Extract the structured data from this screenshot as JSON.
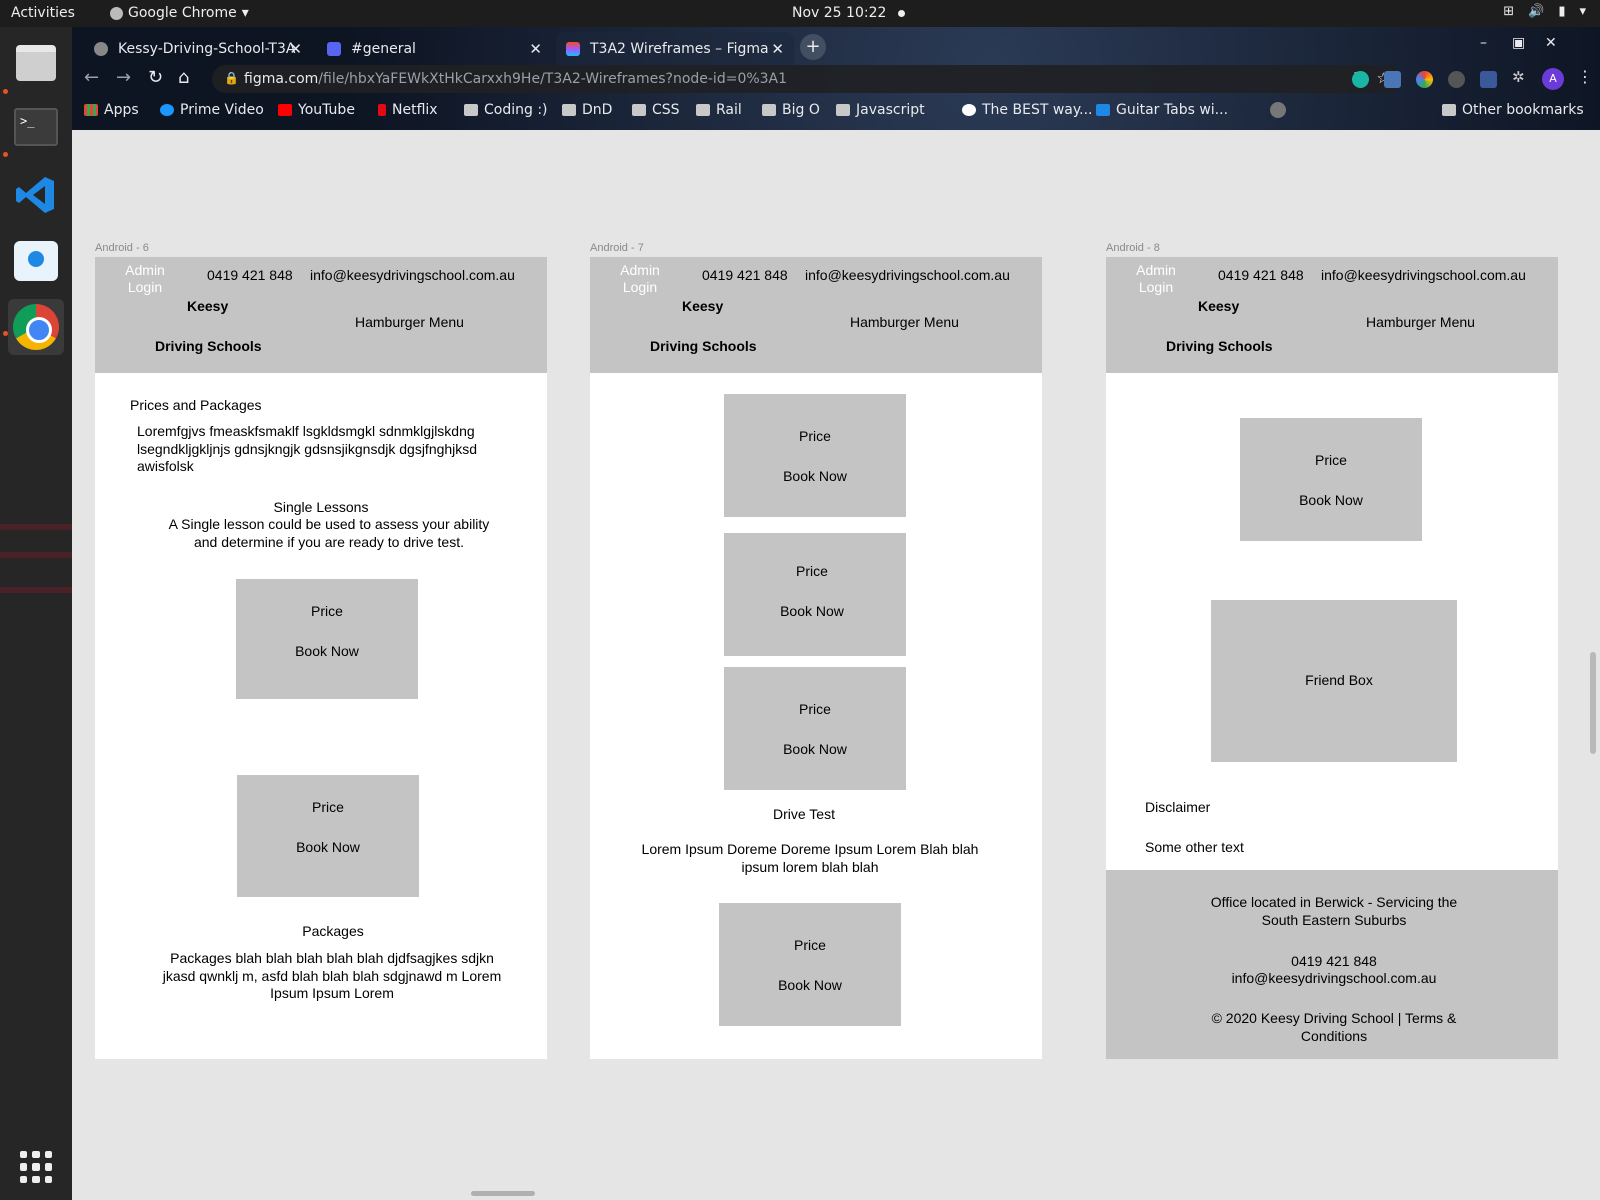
{
  "topbar": {
    "activities": "Activities",
    "app": "Google Chrome",
    "clock": "Nov 25  10:22"
  },
  "browser": {
    "tabs": [
      {
        "title": "Kessy-Driving-School-T3A",
        "icon": "github-icon"
      },
      {
        "title": "#general",
        "icon": "discord-icon"
      },
      {
        "title": "T3A2 Wireframes – Figma",
        "icon": "figma-icon"
      }
    ],
    "url_host": "figma.com",
    "url_path": "/file/hbxYaFEWkXtHkCarxxh9He/T3A2-Wireframes?node-id=0%3A1",
    "avatar_initial": "A",
    "bookmarks": [
      "Apps",
      "Prime Video",
      "YouTube",
      "Netflix",
      "Coding :)",
      "DnD",
      "CSS",
      "Rail",
      "Big O",
      "Javascript",
      "The BEST way...",
      "Guitar Tabs wi...",
      "Other bookmarks"
    ]
  },
  "header": {
    "admin_login": "Admin Login",
    "phone": "0419 421 848",
    "email": "info@keesydrivingschool.com.au",
    "brand_line1": "Keesy",
    "brand_line2": "Driving Schools",
    "menu": "Hamburger Menu"
  },
  "card": {
    "price": "Price",
    "book": "Book Now"
  },
  "frames": [
    {
      "label": "Android - 6",
      "heading": "Prices and Packages",
      "intro": "Loremfgjvs fmeaskfsmaklf lsgkldsmgkl  sdnmklgjlskdng lsegndkljgkljnjs gdnsjkngjk gdsnsjikgnsdjk dgsjfnghjksd awisfolsk",
      "single_title": "Single Lessons",
      "single_text": "A Single lesson could be used to assess your ability and determine if you are ready to drive test.",
      "packages_title": "Packages",
      "packages_text": "Packages blah blah blah blah blah djdfsagjkes sdjkn jkasd qwnklj m, asfd blah blah blah sdgjnawd m Lorem Ipsum Ipsum Lorem"
    },
    {
      "label": "Android - 7",
      "drive_title": "Drive Test",
      "drive_text": "Lorem Ipsum Doreme Doreme Ipsum Lorem Blah blah ipsum lorem blah blah"
    },
    {
      "label": "Android - 8",
      "friend_box": "Friend Box",
      "disclaimer": "Disclaimer",
      "other_text": "Some other text",
      "footer_office": "Office located in Berwick - Servicing the South Eastern Suburbs",
      "footer_phone": "0419 421 848",
      "footer_email": "info@keesydrivingschool.com.au",
      "footer_copyright": "© 2020 Keesy Driving School | Terms & Conditions"
    }
  ]
}
